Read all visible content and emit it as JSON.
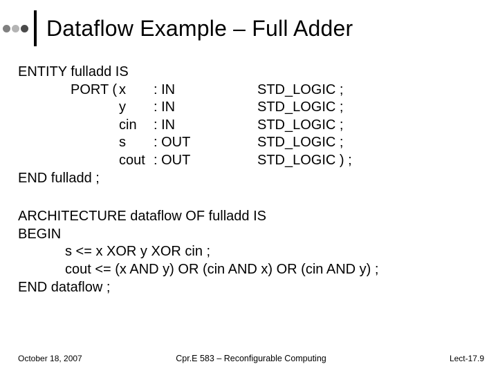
{
  "title": "Dataflow Example – Full Adder",
  "code1": {
    "l1": "ENTITY fulladd IS",
    "port_label": "PORT ( ",
    "ports": [
      {
        "name": "x",
        "dir": ": IN",
        "type": "STD_LOGIC ;"
      },
      {
        "name": "y",
        "dir": ": IN",
        "type": "STD_LOGIC ;"
      },
      {
        "name": "cin",
        "dir": ": IN",
        "type": "STD_LOGIC ;"
      },
      {
        "name": "s",
        "dir": ": OUT",
        "type": "STD_LOGIC ;"
      },
      {
        "name": "cout",
        "dir": ": OUT",
        "type": "STD_LOGIC ) ;"
      }
    ],
    "end": "END fulladd ;"
  },
  "code2": {
    "l1": "ARCHITECTURE dataflow OF fulladd IS",
    "l2": "BEGIN",
    "l3": "s <= x XOR y XOR cin ;",
    "l4": "cout <= (x AND y) OR (cin AND x) OR (cin AND y) ;",
    "l5": "END dataflow ;"
  },
  "footer": {
    "left": "October 18, 2007",
    "center": "Cpr.E 583 – Reconfigurable Computing",
    "right": "Lect-17.9"
  }
}
